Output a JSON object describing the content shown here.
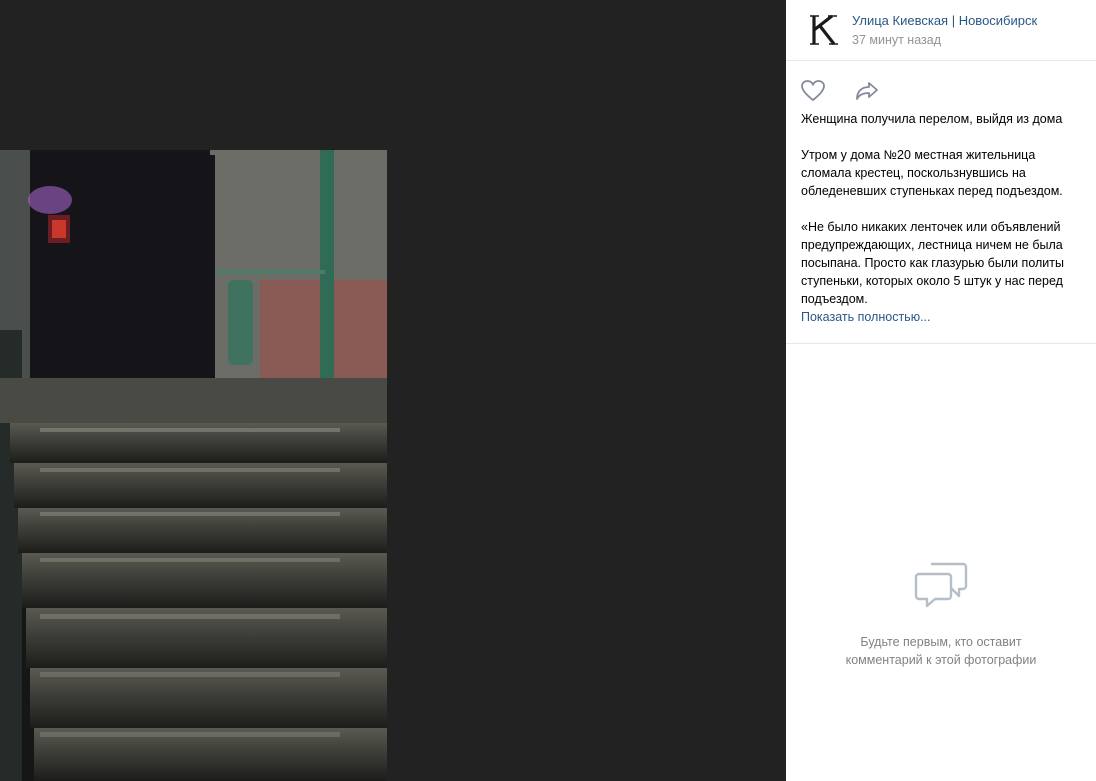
{
  "post": {
    "author": "Улица Киевская | Новосибирск",
    "time": "37 минут назад",
    "title": "Женщина получила перелом, выйдя из дома",
    "paragraph1": "Утром у дома №20 местная жительница сломала крестец, поскользнувшись на обледеневших ступеньках перед подъездом.",
    "paragraph2": "«Не было никаких ленточек или объявлений предупреждающих, лестница ничем не была посыпана. Просто как глазурью были политы ступеньки, которых около 5 штук у нас перед подъездом.",
    "show_more": "Показать полностью..."
  },
  "comments": {
    "empty_line1": "Будьте первым, кто оставит",
    "empty_line2": "комментарий к этой фотографии"
  },
  "icons": {
    "like": "heart-icon",
    "share": "share-arrow-icon",
    "comments_empty": "speech-bubbles-icon"
  }
}
